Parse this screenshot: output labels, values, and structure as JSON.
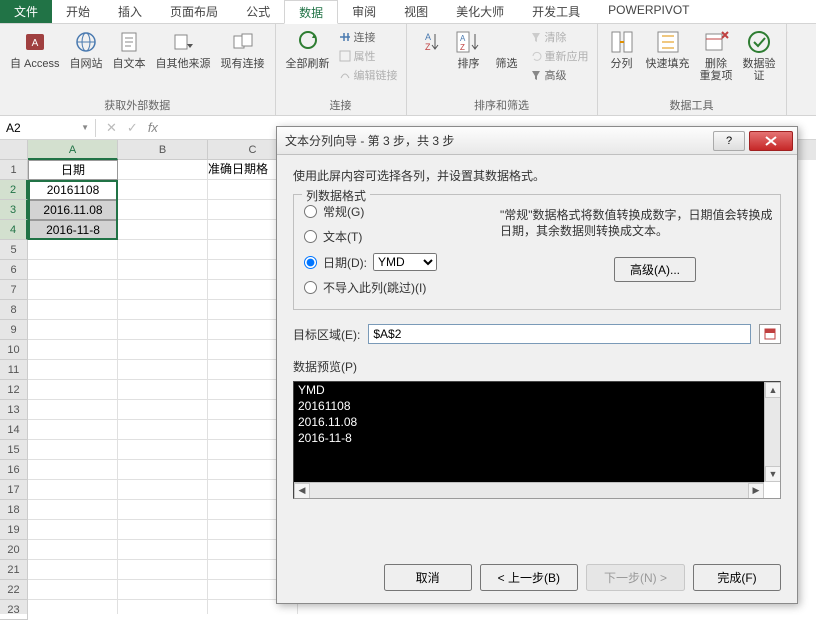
{
  "tabs": {
    "file": "文件",
    "home": "开始",
    "insert": "插入",
    "pagelayout": "页面布局",
    "formulas": "公式",
    "data": "数据",
    "review": "审阅",
    "view": "视图",
    "beautify": "美化大师",
    "developer": "开发工具",
    "powerpivot": "POWERPIVOT"
  },
  "ribbon": {
    "group_external": "获取外部数据",
    "access": "自 Access",
    "web": "自网站",
    "text": "自文本",
    "other": "自其他来源",
    "existing": "现有连接",
    "group_conn": "连接",
    "refreshall": "全部刷新",
    "connections": "连接",
    "properties": "属性",
    "editlinks": "编辑链接",
    "group_sort": "排序和筛选",
    "sort": "排序",
    "filter": "筛选",
    "clear": "清除",
    "reapply": "重新应用",
    "advanced": "高级",
    "group_tools": "数据工具",
    "texttocols": "分列",
    "flashfill": "快速填充",
    "removedup": "删除\n重复项",
    "datavalid": "数据验\n证"
  },
  "namebox": "A2",
  "sheet": {
    "colA": "A",
    "colB": "B",
    "colC": "C",
    "hdr": "日期",
    "c_hdr": "准确日期格",
    "r2": "20161108",
    "r3": "2016.11.08",
    "r4": "2016-11-8"
  },
  "dialog": {
    "title": "文本分列向导 - 第 3 步，共 3 步",
    "desc": "使用此屏内容可选择各列，并设置其数据格式。",
    "fieldset": "列数据格式",
    "opt_general": "常规(G)",
    "opt_text": "文本(T)",
    "opt_date": "日期(D):",
    "date_fmt": "YMD",
    "opt_skip": "不导入此列(跳过)(I)",
    "help": "\"常规\"数据格式将数值转换成数字，日期值会转换成日期，其余数据则转换成文本。",
    "advanced": "高级(A)...",
    "target_lbl": "目标区域(E):",
    "target_val": "$A$2",
    "preview_lbl": "数据预览(P)",
    "preview_hdr": "YMD",
    "preview_rows": [
      "20161108",
      "2016.11.08",
      "2016-11-8"
    ],
    "btn_cancel": "取消",
    "btn_back": "< 上一步(B)",
    "btn_next": "下一步(N) >",
    "btn_finish": "完成(F)"
  }
}
